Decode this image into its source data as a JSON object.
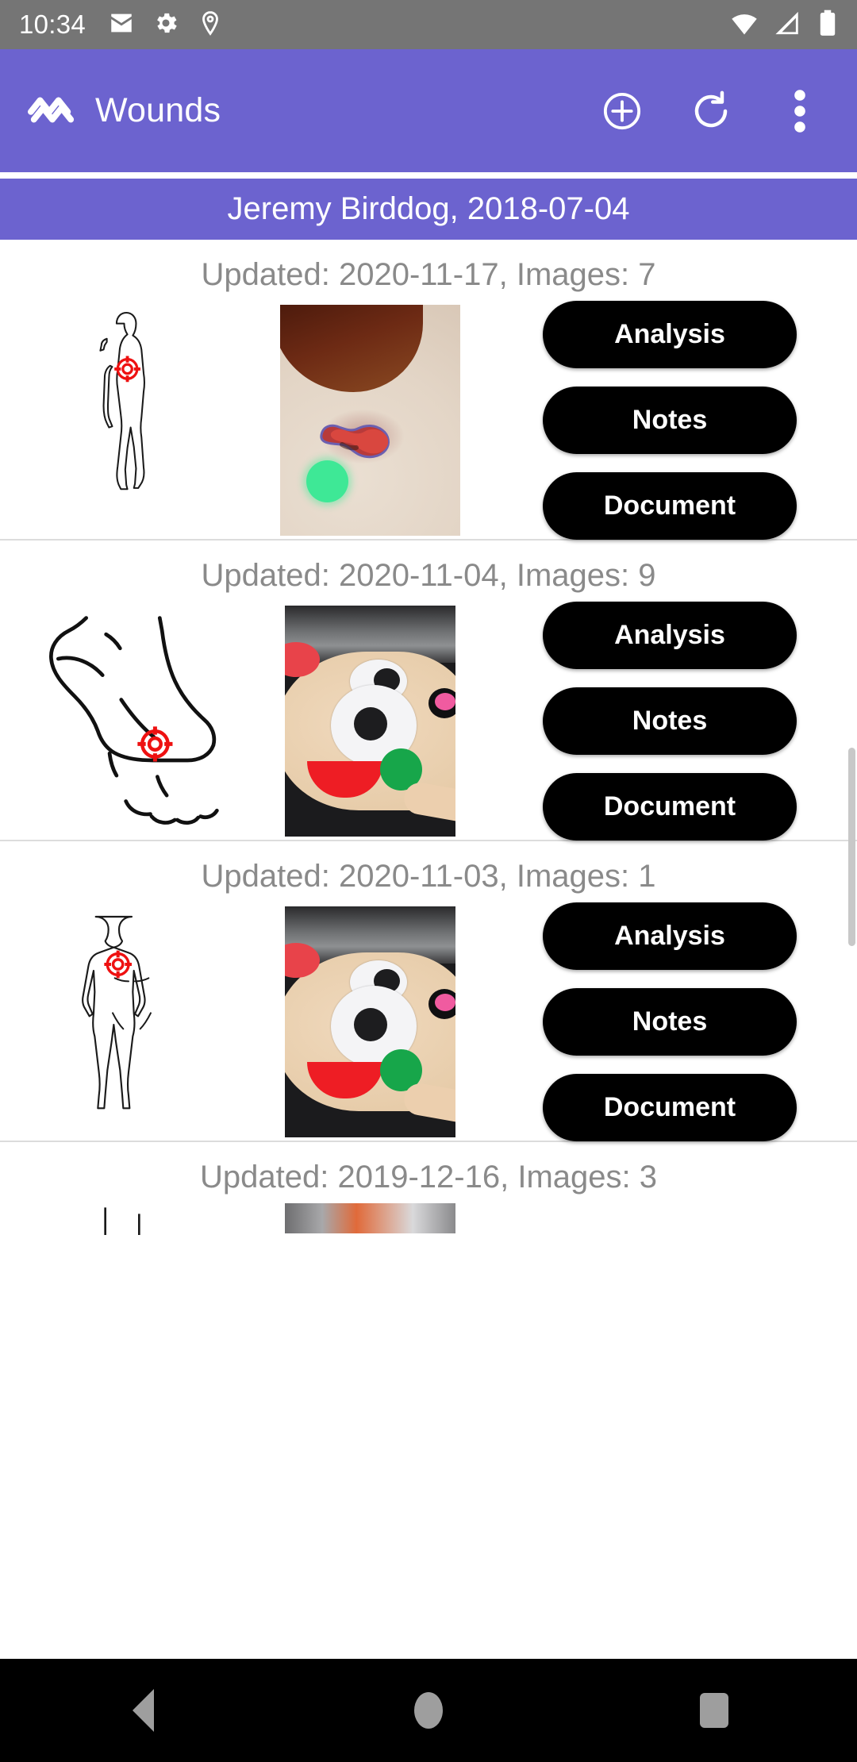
{
  "status_bar": {
    "clock": "10:34",
    "left_icons": [
      "mail-icon",
      "gear-icon",
      "location-pin-icon"
    ],
    "right_icons": [
      "wifi-icon",
      "cellular-signal-icon",
      "battery-icon"
    ],
    "background_color": "#757575"
  },
  "app_bar": {
    "logo_icon": "wounds-waves-logo-icon",
    "title": "Wounds",
    "background_color": "#6c63cf",
    "actions": [
      {
        "name": "add-wound-button",
        "icon": "plus-circle-icon"
      },
      {
        "name": "refresh-button",
        "icon": "refresh-icon"
      },
      {
        "name": "overflow-menu-button",
        "icon": "more-vertical-icon"
      }
    ]
  },
  "patient_banner": {
    "text": "Jeremy Birddog, 2018-07-04",
    "background_color": "#6c63cf"
  },
  "buttons": {
    "analysis": "Analysis",
    "notes": "Notes",
    "document": "Document"
  },
  "wound_list": [
    {
      "header": "Updated: 2020-11-17, Images: 7",
      "updated": "2020-11-17",
      "images": 7,
      "diagram": "body-side-profile-diagram",
      "marker_color": "#ee1111",
      "photo": "wound-photo-shoulder-lesion"
    },
    {
      "header": "Updated: 2020-11-04, Images: 9",
      "updated": "2020-11-04",
      "images": 9,
      "diagram": "foot-outline-diagram",
      "marker_color": "#ee1111",
      "photo": "wound-photo-plush-foot"
    },
    {
      "header": "Updated: 2020-11-03, Images: 1",
      "updated": "2020-11-03",
      "images": 1,
      "diagram": "body-front-diagram",
      "marker_color": "#ee1111",
      "photo": "wound-photo-plush-foot"
    },
    {
      "header": "Updated: 2019-12-16, Images: 3",
      "updated": "2019-12-16",
      "images": 3,
      "diagram": "body-diagram-partial",
      "marker_color": "#ee1111",
      "photo": "wound-photo-partial"
    }
  ],
  "nav_bar": {
    "background_color": "#000000",
    "items": [
      {
        "name": "nav-back-button",
        "icon": "triangle-back-icon"
      },
      {
        "name": "nav-home-button",
        "icon": "circle-home-icon"
      },
      {
        "name": "nav-recents-button",
        "icon": "square-recents-icon"
      }
    ]
  }
}
